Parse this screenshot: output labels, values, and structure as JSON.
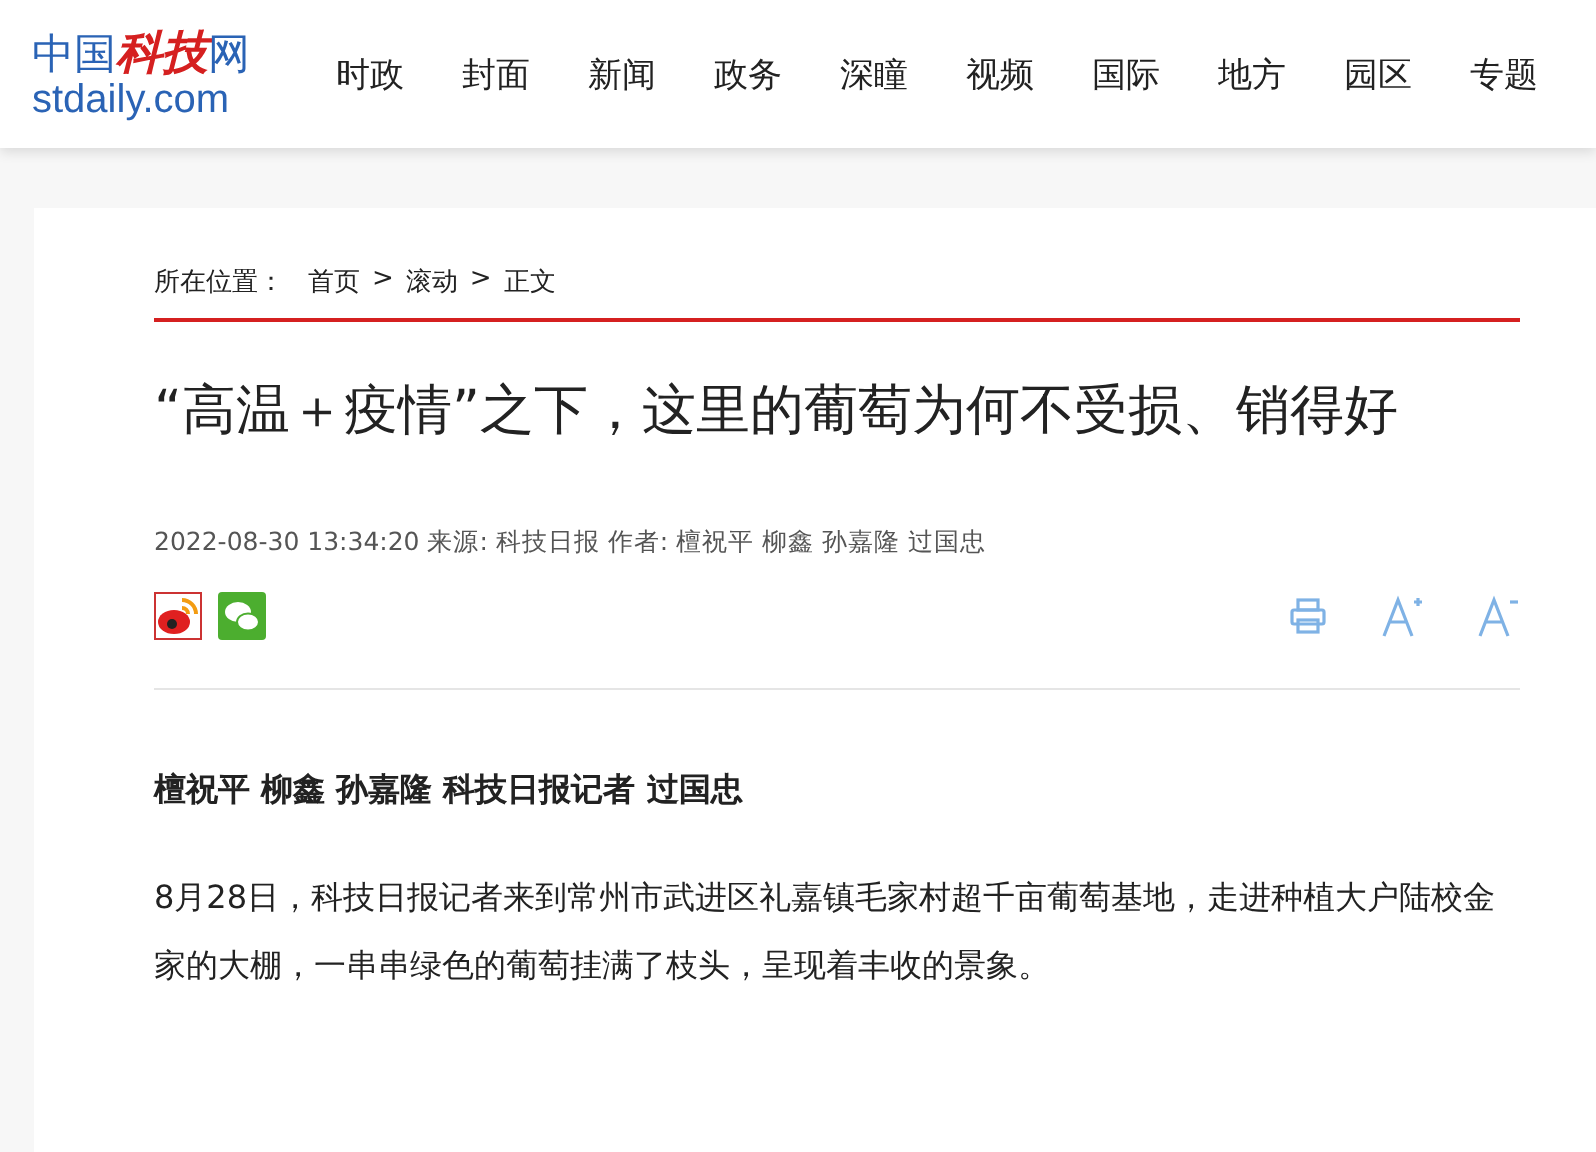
{
  "header": {
    "logo": {
      "cn_left": "中国",
      "cn_brand": "科技",
      "cn_right": "网",
      "domain": "stdaily.com"
    },
    "nav": [
      "时政",
      "封面",
      "新闻",
      "政务",
      "深瞳",
      "视频",
      "国际",
      "地方",
      "园区",
      "专题"
    ]
  },
  "breadcrumb": {
    "label": "所在位置：",
    "items": [
      "首页",
      "滚动",
      "正文"
    ],
    "separator": ">"
  },
  "article": {
    "title": "“高温＋疫情”之下，这里的葡萄为何不受损、销得好",
    "meta": "2022-08-30 13:34:20 来源: 科技日报 作者: 檀祝平 柳鑫 孙嘉隆 过国忠",
    "byline": "檀祝平 柳鑫 孙嘉隆 科技日报记者 过国忠",
    "paragraphs": [
      "8月28日，科技日报记者来到常州市武进区礼嘉镇毛家村超千亩葡萄基地，走进种植大户陆校金家的大棚，一串串绿色的葡萄挂满了枝头，呈现着丰收的景象。"
    ]
  }
}
